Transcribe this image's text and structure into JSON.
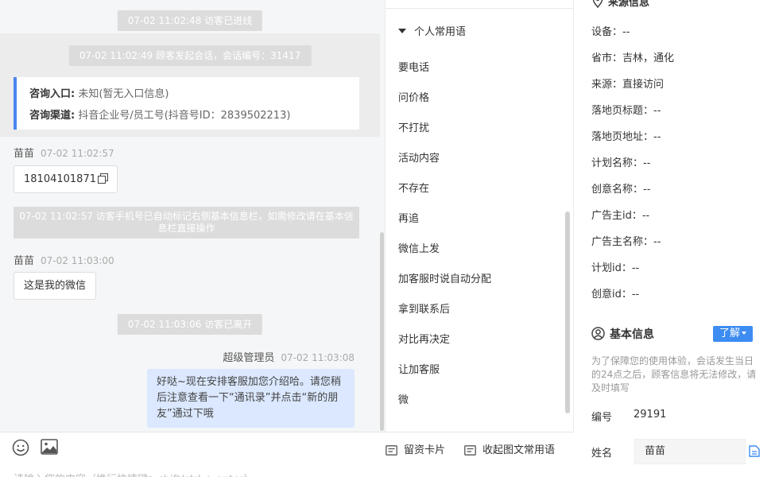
{
  "chat": {
    "sys_entered": "07-02 11:02:48 访客已进线",
    "sys_session": "07-02 11:02:49 顾客发起会话，会话编号：31417",
    "info": {
      "entry_label": "咨询入口:",
      "entry_value": "未知(暂无入口信息)",
      "channel_label": "咨询渠道:",
      "channel_value": "抖音企业号/员工号(抖音号ID：2839502213)"
    },
    "msg1": {
      "sender": "苗苗",
      "time": "07-02 11:02:57",
      "text": "18104101871"
    },
    "sys_phone": "07-02 11:02:57 访客手机号已自动标记右侧基本信息栏，如需修改请在基本信息栏直接操作",
    "msg2": {
      "sender": "苗苗",
      "time": "07-02 11:03:00",
      "text": "这是我的微信"
    },
    "sys_left": "07-02 11:03:06 访客已离开",
    "msg3": {
      "sender": "超级管理员",
      "time": "07-02 11:03:08",
      "text": "好哒~现在安排客服加您介绍哈。请您稍后注意查看一下“通讯录”并点击“新的朋友”通过下哦"
    }
  },
  "input": {
    "placeholder": "请输入您的内容（换行快捷键：shift/ctrl + enter）",
    "card_label": "留资卡片",
    "collapse_label": "收起图文常用语"
  },
  "phrases": {
    "header": "个人常用语",
    "items": [
      "要电话",
      "问价格",
      "不打扰",
      "活动内容",
      "不存在",
      "再追",
      "微信上发",
      "加客服时说自动分配",
      "拿到联系后",
      "对比再决定",
      "让加客服",
      "微"
    ]
  },
  "source": {
    "title": "来源信息",
    "rows": [
      "设备：--",
      "省市：吉林，通化",
      "来源：直接访问",
      "落地页标题：--",
      "落地页地址：--",
      "计划名称：--",
      "创意名称：--",
      "广告主id：--",
      "广告主名称：--",
      "计划id：--",
      "创意id：--"
    ]
  },
  "basic": {
    "title": "基本信息",
    "learn_label": "了解",
    "notice": "为了保障您的使用体验，会话发生当日的24点之后，顾客信息将无法修改，请及时填写",
    "id_label": "编号",
    "id_value": "29191",
    "name_label": "姓名",
    "name_value": "苗苗"
  },
  "colors": {
    "accent": "#3d8cf1",
    "info_bar": "#4a86f0",
    "agent_bubble": "#dbe8ff",
    "system_notice": "#dcdcdc"
  },
  "icons": [
    "emoji-icon",
    "image-icon",
    "card-icon",
    "collapse-icon",
    "copy-icon",
    "user-icon",
    "location-icon"
  ]
}
